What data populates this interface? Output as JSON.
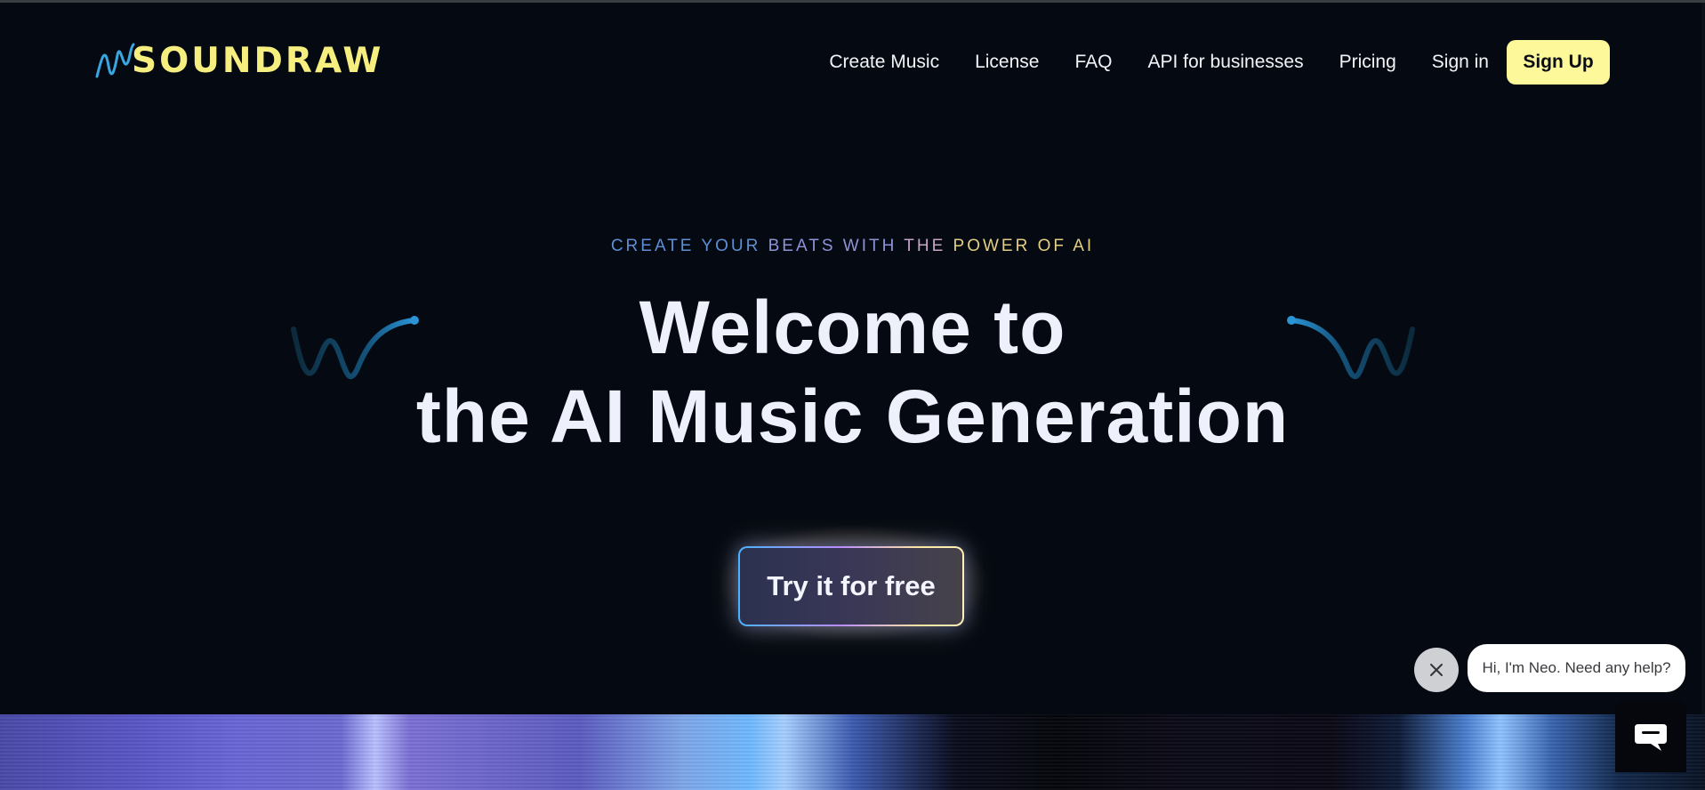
{
  "brand": {
    "name": "SOUNDRAW",
    "logo_color": "#f6ee7f",
    "icon": "wave-logo-icon",
    "icon_color": "#3aa6e0"
  },
  "nav": {
    "items": [
      "Create Music",
      "License",
      "FAQ",
      "API for businesses",
      "Pricing",
      "Sign in"
    ],
    "signup_label": "Sign Up",
    "signup_color": "#fdf89a"
  },
  "hero": {
    "eyebrow_parts": [
      "CREATE YOUR",
      "BEATS WITH",
      "THE",
      "POWER OF AI"
    ],
    "headline_line1": "Welcome to",
    "headline_line2": "the AI Music Generation",
    "decor_icon": "sound-wave-icon",
    "cta_label": "Try it for free"
  },
  "chat": {
    "close_icon": "close-icon",
    "greeting": "Hi, I'm Neo. Need any help?",
    "launcher_icon": "chat-bubble-icon"
  },
  "colors": {
    "background": "#050a12",
    "text": "#eef1fb"
  }
}
